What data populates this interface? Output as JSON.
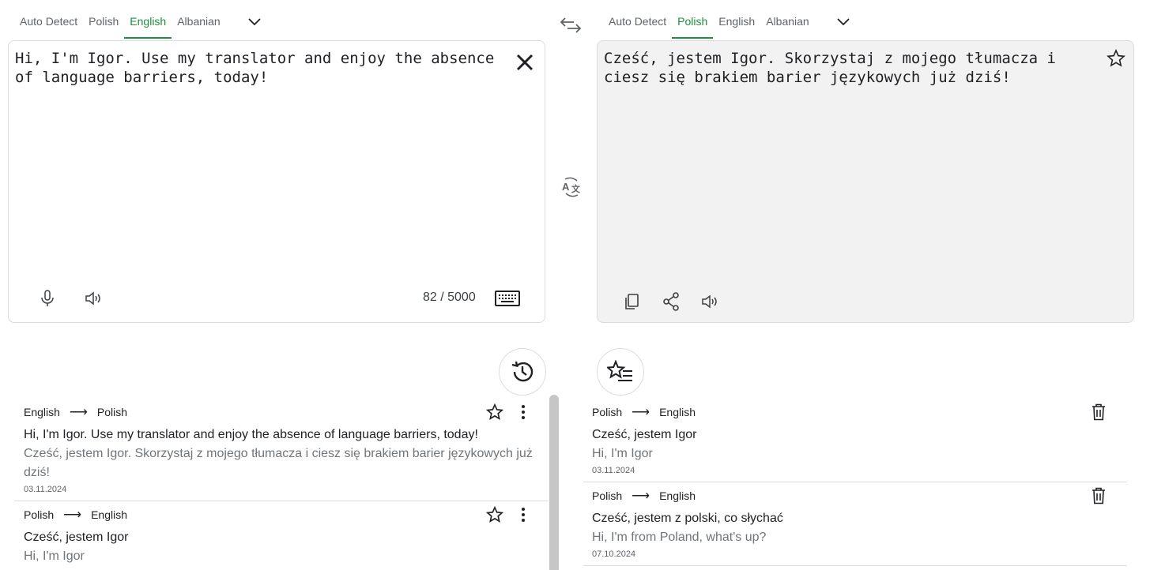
{
  "source_lang_tabs": [
    {
      "label": "Auto Detect",
      "active": false
    },
    {
      "label": "Polish",
      "active": false
    },
    {
      "label": "English",
      "active": true
    },
    {
      "label": "Albanian",
      "active": false
    }
  ],
  "target_lang_tabs": [
    {
      "label": "Auto Detect",
      "active": false
    },
    {
      "label": "Polish",
      "active": true
    },
    {
      "label": "English",
      "active": false
    },
    {
      "label": "Albanian",
      "active": false
    }
  ],
  "source": {
    "text": "Hi, I'm Igor. Use my translator and enjoy the absence of language barriers, today!",
    "char_count": "82 / 5000"
  },
  "target": {
    "text": "Cześć, jestem Igor. Skorzystaj z mojego tłumacza i ciesz się brakiem barier językowych już dziś!"
  },
  "icons": {
    "swap": "swap-arrows-icon",
    "translate": "translate-icon",
    "clear": "close-icon",
    "mic": "microphone-icon",
    "speaker": "speaker-icon",
    "keyboard": "keyboard-icon",
    "copy": "copy-icon",
    "share": "share-icon",
    "star": "star-icon",
    "history": "history-icon",
    "saved": "saved-list-icon",
    "more": "more-vert-icon",
    "delete": "trash-icon"
  },
  "history": [
    {
      "from": "English",
      "to": "Polish",
      "source": "Hi, I'm Igor. Use my translator and enjoy the absence of language barriers, today!",
      "target": "Cześć, jestem Igor. Skorzystaj z mojego tłumacza i ciesz się brakiem barier językowych już dziś!",
      "date": "03.11.2024"
    },
    {
      "from": "Polish",
      "to": "English",
      "source": "Cześć, jestem Igor",
      "target": "Hi, I'm Igor",
      "date": ""
    }
  ],
  "saved": [
    {
      "from": "Polish",
      "to": "English",
      "source": "Cześć, jestem Igor",
      "target": "Hi, I'm Igor",
      "date": "03.11.2024"
    },
    {
      "from": "Polish",
      "to": "English",
      "source": "Cześć, jestem z polski, co słychać",
      "target": "Hi, I'm from Poland, what's up?",
      "date": "07.10.2024"
    }
  ],
  "colors": {
    "accent": "#1e8e3e",
    "target_panel_bg": "#f2f2f2",
    "border": "#dadce0"
  }
}
